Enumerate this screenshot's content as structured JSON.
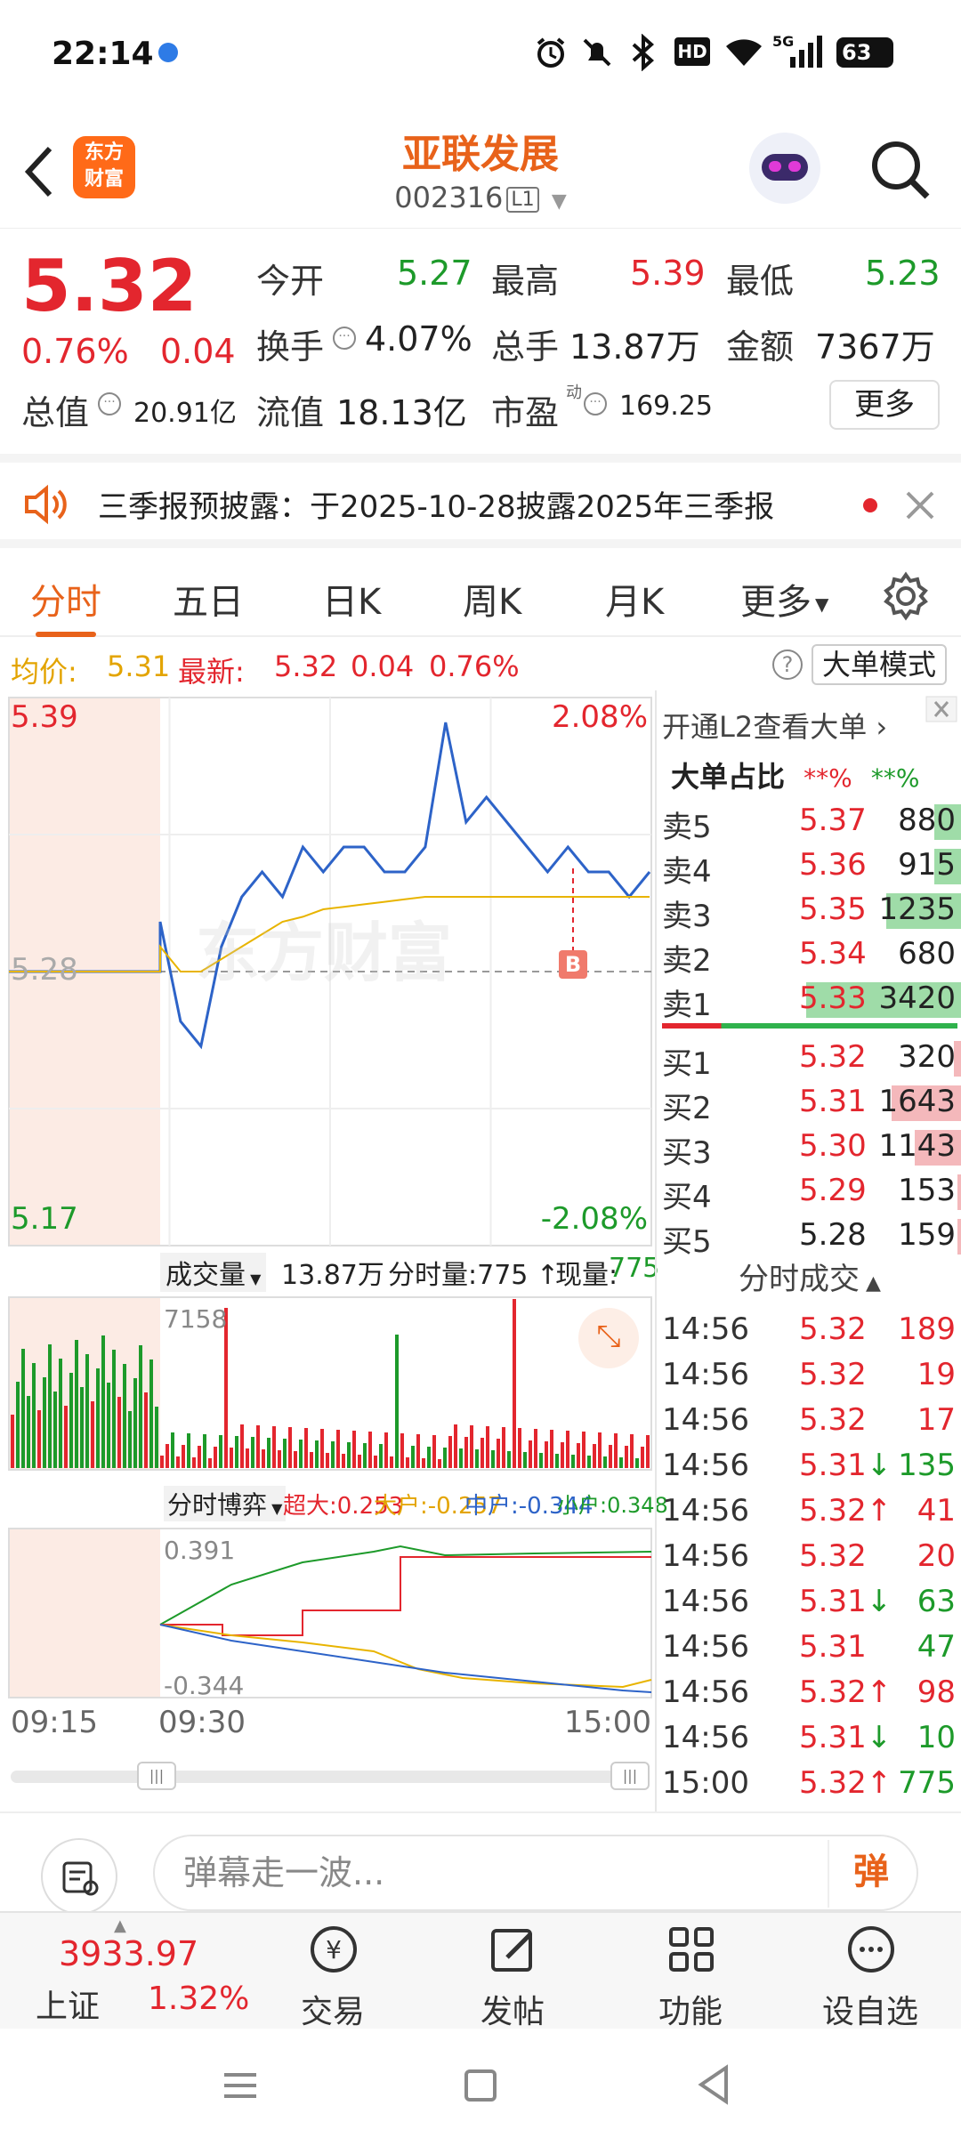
{
  "status_bar": {
    "time": "22:14",
    "battery": "63"
  },
  "header": {
    "logo_text_1": "东方",
    "logo_text_2": "财富",
    "stock_name": "亚联发展",
    "stock_code": "002316",
    "level": "L1"
  },
  "quote": {
    "price": "5.32",
    "change_pct": "0.76%",
    "change": "0.04",
    "open_label": "今开",
    "open": "5.27",
    "high_label": "最高",
    "high": "5.39",
    "low_label": "最低",
    "low": "5.23",
    "turnover_label": "换手",
    "turnover": "4.07%",
    "volume_label": "总手",
    "volume": "13.87万",
    "amount_label": "金额",
    "amount": "7367万",
    "mktcap_label": "总值",
    "mktcap": "20.91亿",
    "float_label": "流值",
    "float_cap": "18.13亿",
    "pe_label": "市盈",
    "pe_sup": "动",
    "pe": "169.25",
    "more": "更多"
  },
  "notice": {
    "text": "三季报预披露：于2025-10-28披露2025年三季报"
  },
  "tabs": [
    "分时",
    "五日",
    "日K",
    "周K",
    "月K",
    "更多"
  ],
  "info_line": {
    "avg_label": "均价:",
    "avg": "5.31",
    "latest_label": "最新:",
    "latest": "5.32",
    "change": "0.04",
    "change_pct": "0.76%",
    "big_mode": "大单模式"
  },
  "chart": {
    "price_high": "5.39",
    "price_mid": "5.28",
    "price_low": "5.17",
    "pct_high": "2.08%",
    "pct_low": "-2.08%",
    "marker": "B",
    "watermark": "东方财富",
    "volume_selector": "成交量",
    "volume_total": "13.87万",
    "tick_volume": "分时量:775",
    "current_volume_label": "现量:",
    "current_volume": "775",
    "volume_max": "7158",
    "game_selector": "分时博弈",
    "super_label": "超大:0.253",
    "large_label": "大户:-0.257",
    "mid_label": "中户:-0.344",
    "small_label": "小户:0.348",
    "game_max": "0.391",
    "game_min": "-0.344",
    "time_start": "09:15",
    "time_open": "09:30",
    "time_end": "15:00"
  },
  "chart_data": {
    "type": "line",
    "title": "",
    "xlabel": "",
    "ylabel": "",
    "ylim": [
      5.17,
      5.39
    ],
    "x_ticks": [
      "09:15",
      "09:30",
      "15:00"
    ],
    "series": [
      {
        "name": "",
        "color": "#2d63c8",
        "values": [
          5.28,
          5.28,
          5.28,
          5.28,
          5.3,
          5.26,
          5.25,
          5.29,
          5.31,
          5.32,
          5.31,
          5.33,
          5.32,
          5.33,
          5.33,
          5.32,
          5.32,
          5.33,
          5.38,
          5.34,
          5.35,
          5.34,
          5.33,
          5.32,
          5.33,
          5.32,
          5.32,
          5.31,
          5.32
        ]
      },
      {
        "name": "",
        "color": "#e8b400",
        "values": [
          5.28,
          5.28,
          5.28,
          5.28,
          5.29,
          5.28,
          5.28,
          5.285,
          5.29,
          5.295,
          5.3,
          5.302,
          5.305,
          5.306,
          5.307,
          5.308,
          5.309,
          5.31,
          5.31,
          5.31,
          5.31,
          5.31,
          5.31,
          5.31,
          5.31,
          5.31,
          5.31,
          5.31,
          5.31
        ]
      }
    ]
  },
  "order_book": {
    "promo": "开通L2查看大单",
    "ratio_label": "大单占比",
    "ratio_red": "**%",
    "ratio_green": "**%",
    "asks": [
      {
        "label": "卖5",
        "price": "5.37",
        "vol": "880",
        "bar": 0.1
      },
      {
        "label": "卖4",
        "price": "5.36",
        "vol": "915",
        "bar": 0.1
      },
      {
        "label": "卖3",
        "price": "5.35",
        "vol": "1235",
        "bar": 0.27
      },
      {
        "label": "卖2",
        "price": "5.34",
        "vol": "680",
        "bar": 0.0
      },
      {
        "label": "卖1",
        "price": "5.33",
        "vol": "3420",
        "bar": 0.55
      }
    ],
    "bids": [
      {
        "label": "买1",
        "price": "5.32",
        "vol": "320",
        "bar": 0.03
      },
      {
        "label": "买2",
        "price": "5.31",
        "vol": "1643",
        "bar": 0.25
      },
      {
        "label": "买3",
        "price": "5.30",
        "vol": "1143",
        "bar": 0.17
      },
      {
        "label": "买4",
        "price": "5.29",
        "vol": "153",
        "bar": 0.02
      },
      {
        "label": "买5",
        "price": "5.28",
        "vol": "159",
        "bar": 0.02
      }
    ]
  },
  "trades": {
    "title": "分时成交",
    "rows": [
      {
        "time": "14:56",
        "price": "5.32",
        "vol": "189",
        "dir": "",
        "pc": "red",
        "vc": "red"
      },
      {
        "time": "14:56",
        "price": "5.32",
        "vol": "19",
        "dir": "",
        "pc": "red",
        "vc": "red"
      },
      {
        "time": "14:56",
        "price": "5.32",
        "vol": "17",
        "dir": "",
        "pc": "red",
        "vc": "red"
      },
      {
        "time": "14:56",
        "price": "5.31",
        "vol": "135",
        "dir": "↓",
        "pc": "red",
        "vc": "green"
      },
      {
        "time": "14:56",
        "price": "5.32",
        "vol": "41",
        "dir": "↑",
        "pc": "red",
        "vc": "red"
      },
      {
        "time": "14:56",
        "price": "5.32",
        "vol": "20",
        "dir": "",
        "pc": "red",
        "vc": "red"
      },
      {
        "time": "14:56",
        "price": "5.31",
        "vol": "63",
        "dir": "↓",
        "pc": "red",
        "vc": "green"
      },
      {
        "time": "14:56",
        "price": "5.31",
        "vol": "47",
        "dir": "",
        "pc": "red",
        "vc": "green"
      },
      {
        "time": "14:56",
        "price": "5.32",
        "vol": "98",
        "dir": "↑",
        "pc": "red",
        "vc": "red"
      },
      {
        "time": "14:56",
        "price": "5.31",
        "vol": "10",
        "dir": "↓",
        "pc": "red",
        "vc": "green"
      },
      {
        "time": "15:00",
        "price": "5.32",
        "vol": "775",
        "dir": "↑",
        "pc": "red",
        "vc": "green"
      }
    ]
  },
  "comment_bar": {
    "placeholder": "弹幕走一波...",
    "danmu_button": "弹"
  },
  "bottom_nav": {
    "index_value": "3933.97",
    "index_name": "上证",
    "index_change": "1.32%",
    "trade": "交易",
    "post": "发帖",
    "functions": "功能",
    "watchlist": "设自选"
  },
  "colors": {
    "accent": "#e8621a",
    "up": "#e3262e",
    "down": "#1d9a2a",
    "avg_line": "#e8b400",
    "price_line": "#2d63c8"
  }
}
